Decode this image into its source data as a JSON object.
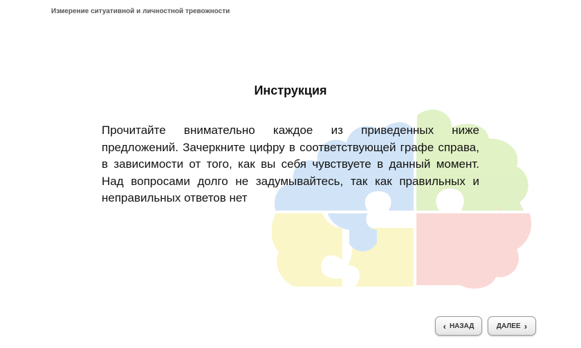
{
  "header": {
    "title": "Измерение ситуативной и личностной тревожности"
  },
  "main": {
    "heading": "Инструкция",
    "body": "Прочитайте внимательно каждое из приведенных ниже предложений. Зачеркните цифру в соответствующей графе справа, в зависимости от того, как вы себя чувствуете в данный момент. Над вопросами долго не задумывайтесь, так как правильных и неправильных ответов нет"
  },
  "navigation": {
    "back_label": "НАЗАД",
    "back_icon": "chevron-left-icon",
    "next_label": "ДАЛЕЕ",
    "next_icon": "chevron-right-icon"
  },
  "colors": {
    "puzzle_green": "#dff1c2",
    "puzzle_blue": "#cfe3f7",
    "puzzle_yellow": "#fbf6c6",
    "puzzle_pink": "#fad6d4"
  }
}
